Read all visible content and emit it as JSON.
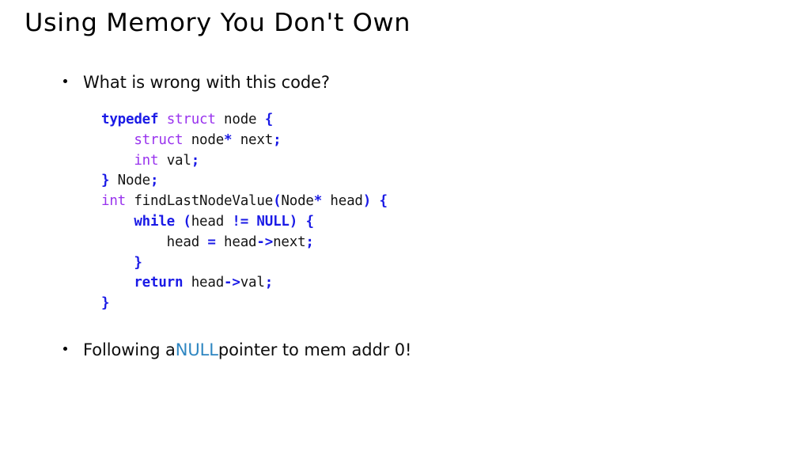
{
  "slide": {
    "title": "Using Memory You Don't Own",
    "background_color": "#ffffff",
    "bullets": {
      "first": {
        "text": "What is wrong with this code?"
      },
      "second": {
        "prefix": "Following a ",
        "highlight": "NULL",
        "suffix": " pointer to mem addr 0!",
        "highlight_color": "#2e86c1"
      }
    },
    "code": {
      "language": "c",
      "syntax_colors": {
        "keyword": "#1a1ae6",
        "type": "#9933ee",
        "punctuation": "#1a1ae6",
        "identifier": "#141414"
      },
      "lines": [
        [
          {
            "t": "typedef",
            "c": "kw"
          },
          {
            "t": " ",
            "c": "plain"
          },
          {
            "t": "struct",
            "c": "type"
          },
          {
            "t": " node ",
            "c": "plain"
          },
          {
            "t": "{",
            "c": "punct"
          }
        ],
        [
          {
            "t": "    ",
            "c": "plain"
          },
          {
            "t": "struct",
            "c": "type"
          },
          {
            "t": " node",
            "c": "plain"
          },
          {
            "t": "*",
            "c": "op"
          },
          {
            "t": " next",
            "c": "plain"
          },
          {
            "t": ";",
            "c": "punct"
          }
        ],
        [
          {
            "t": "    ",
            "c": "plain"
          },
          {
            "t": "int",
            "c": "type"
          },
          {
            "t": " val",
            "c": "plain"
          },
          {
            "t": ";",
            "c": "punct"
          }
        ],
        [
          {
            "t": "}",
            "c": "punct"
          },
          {
            "t": " Node",
            "c": "plain"
          },
          {
            "t": ";",
            "c": "punct"
          }
        ],
        [
          {
            "t": "int",
            "c": "type"
          },
          {
            "t": " findLastNodeValue",
            "c": "plain"
          },
          {
            "t": "(",
            "c": "punct"
          },
          {
            "t": "Node",
            "c": "plain"
          },
          {
            "t": "*",
            "c": "op"
          },
          {
            "t": " head",
            "c": "plain"
          },
          {
            "t": ")",
            "c": "punct"
          },
          {
            "t": " ",
            "c": "plain"
          },
          {
            "t": "{",
            "c": "punct"
          }
        ],
        [
          {
            "t": "    ",
            "c": "plain"
          },
          {
            "t": "while",
            "c": "kw"
          },
          {
            "t": " ",
            "c": "plain"
          },
          {
            "t": "(",
            "c": "punct"
          },
          {
            "t": "head ",
            "c": "plain"
          },
          {
            "t": "!=",
            "c": "op"
          },
          {
            "t": " ",
            "c": "plain"
          },
          {
            "t": "NULL",
            "c": "kw"
          },
          {
            "t": ")",
            "c": "punct"
          },
          {
            "t": " ",
            "c": "plain"
          },
          {
            "t": "{",
            "c": "punct"
          }
        ],
        [
          {
            "t": "        head ",
            "c": "plain"
          },
          {
            "t": "=",
            "c": "op"
          },
          {
            "t": " head",
            "c": "plain"
          },
          {
            "t": "->",
            "c": "op"
          },
          {
            "t": "next",
            "c": "plain"
          },
          {
            "t": ";",
            "c": "punct"
          }
        ],
        [
          {
            "t": "    ",
            "c": "plain"
          },
          {
            "t": "}",
            "c": "punct"
          }
        ],
        [
          {
            "t": "    ",
            "c": "plain"
          },
          {
            "t": "return",
            "c": "kw"
          },
          {
            "t": " head",
            "c": "plain"
          },
          {
            "t": "->",
            "c": "op"
          },
          {
            "t": "val",
            "c": "plain"
          },
          {
            "t": ";",
            "c": "punct"
          }
        ],
        [
          {
            "t": "}",
            "c": "punct"
          }
        ]
      ]
    }
  }
}
